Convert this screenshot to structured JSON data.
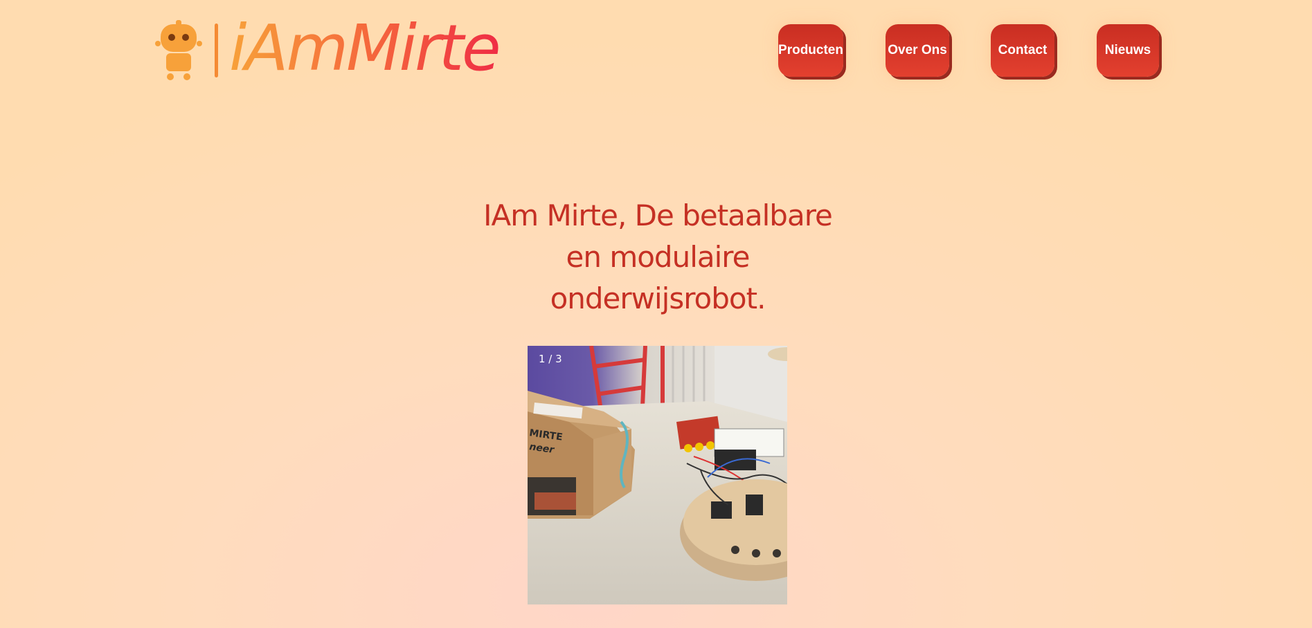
{
  "header": {
    "logo_text": "iAmMirte",
    "nav": [
      {
        "label": "Producten"
      },
      {
        "label": "Over Ons"
      },
      {
        "label": "Contact"
      },
      {
        "label": "Nieuws"
      }
    ]
  },
  "hero": {
    "title_line1": "IAm Mirte, De betaalbare",
    "title_line2": "en modulaire",
    "title_line3": "onderwijsrobot."
  },
  "slideshow": {
    "counter": "1 / 3",
    "box_text_1": "MIRTE",
    "box_text_2": "neer"
  },
  "colors": {
    "accent": "#c53024",
    "button": "#e3402f",
    "logo_start": "#f7a13a",
    "logo_end": "#ef2d45"
  }
}
